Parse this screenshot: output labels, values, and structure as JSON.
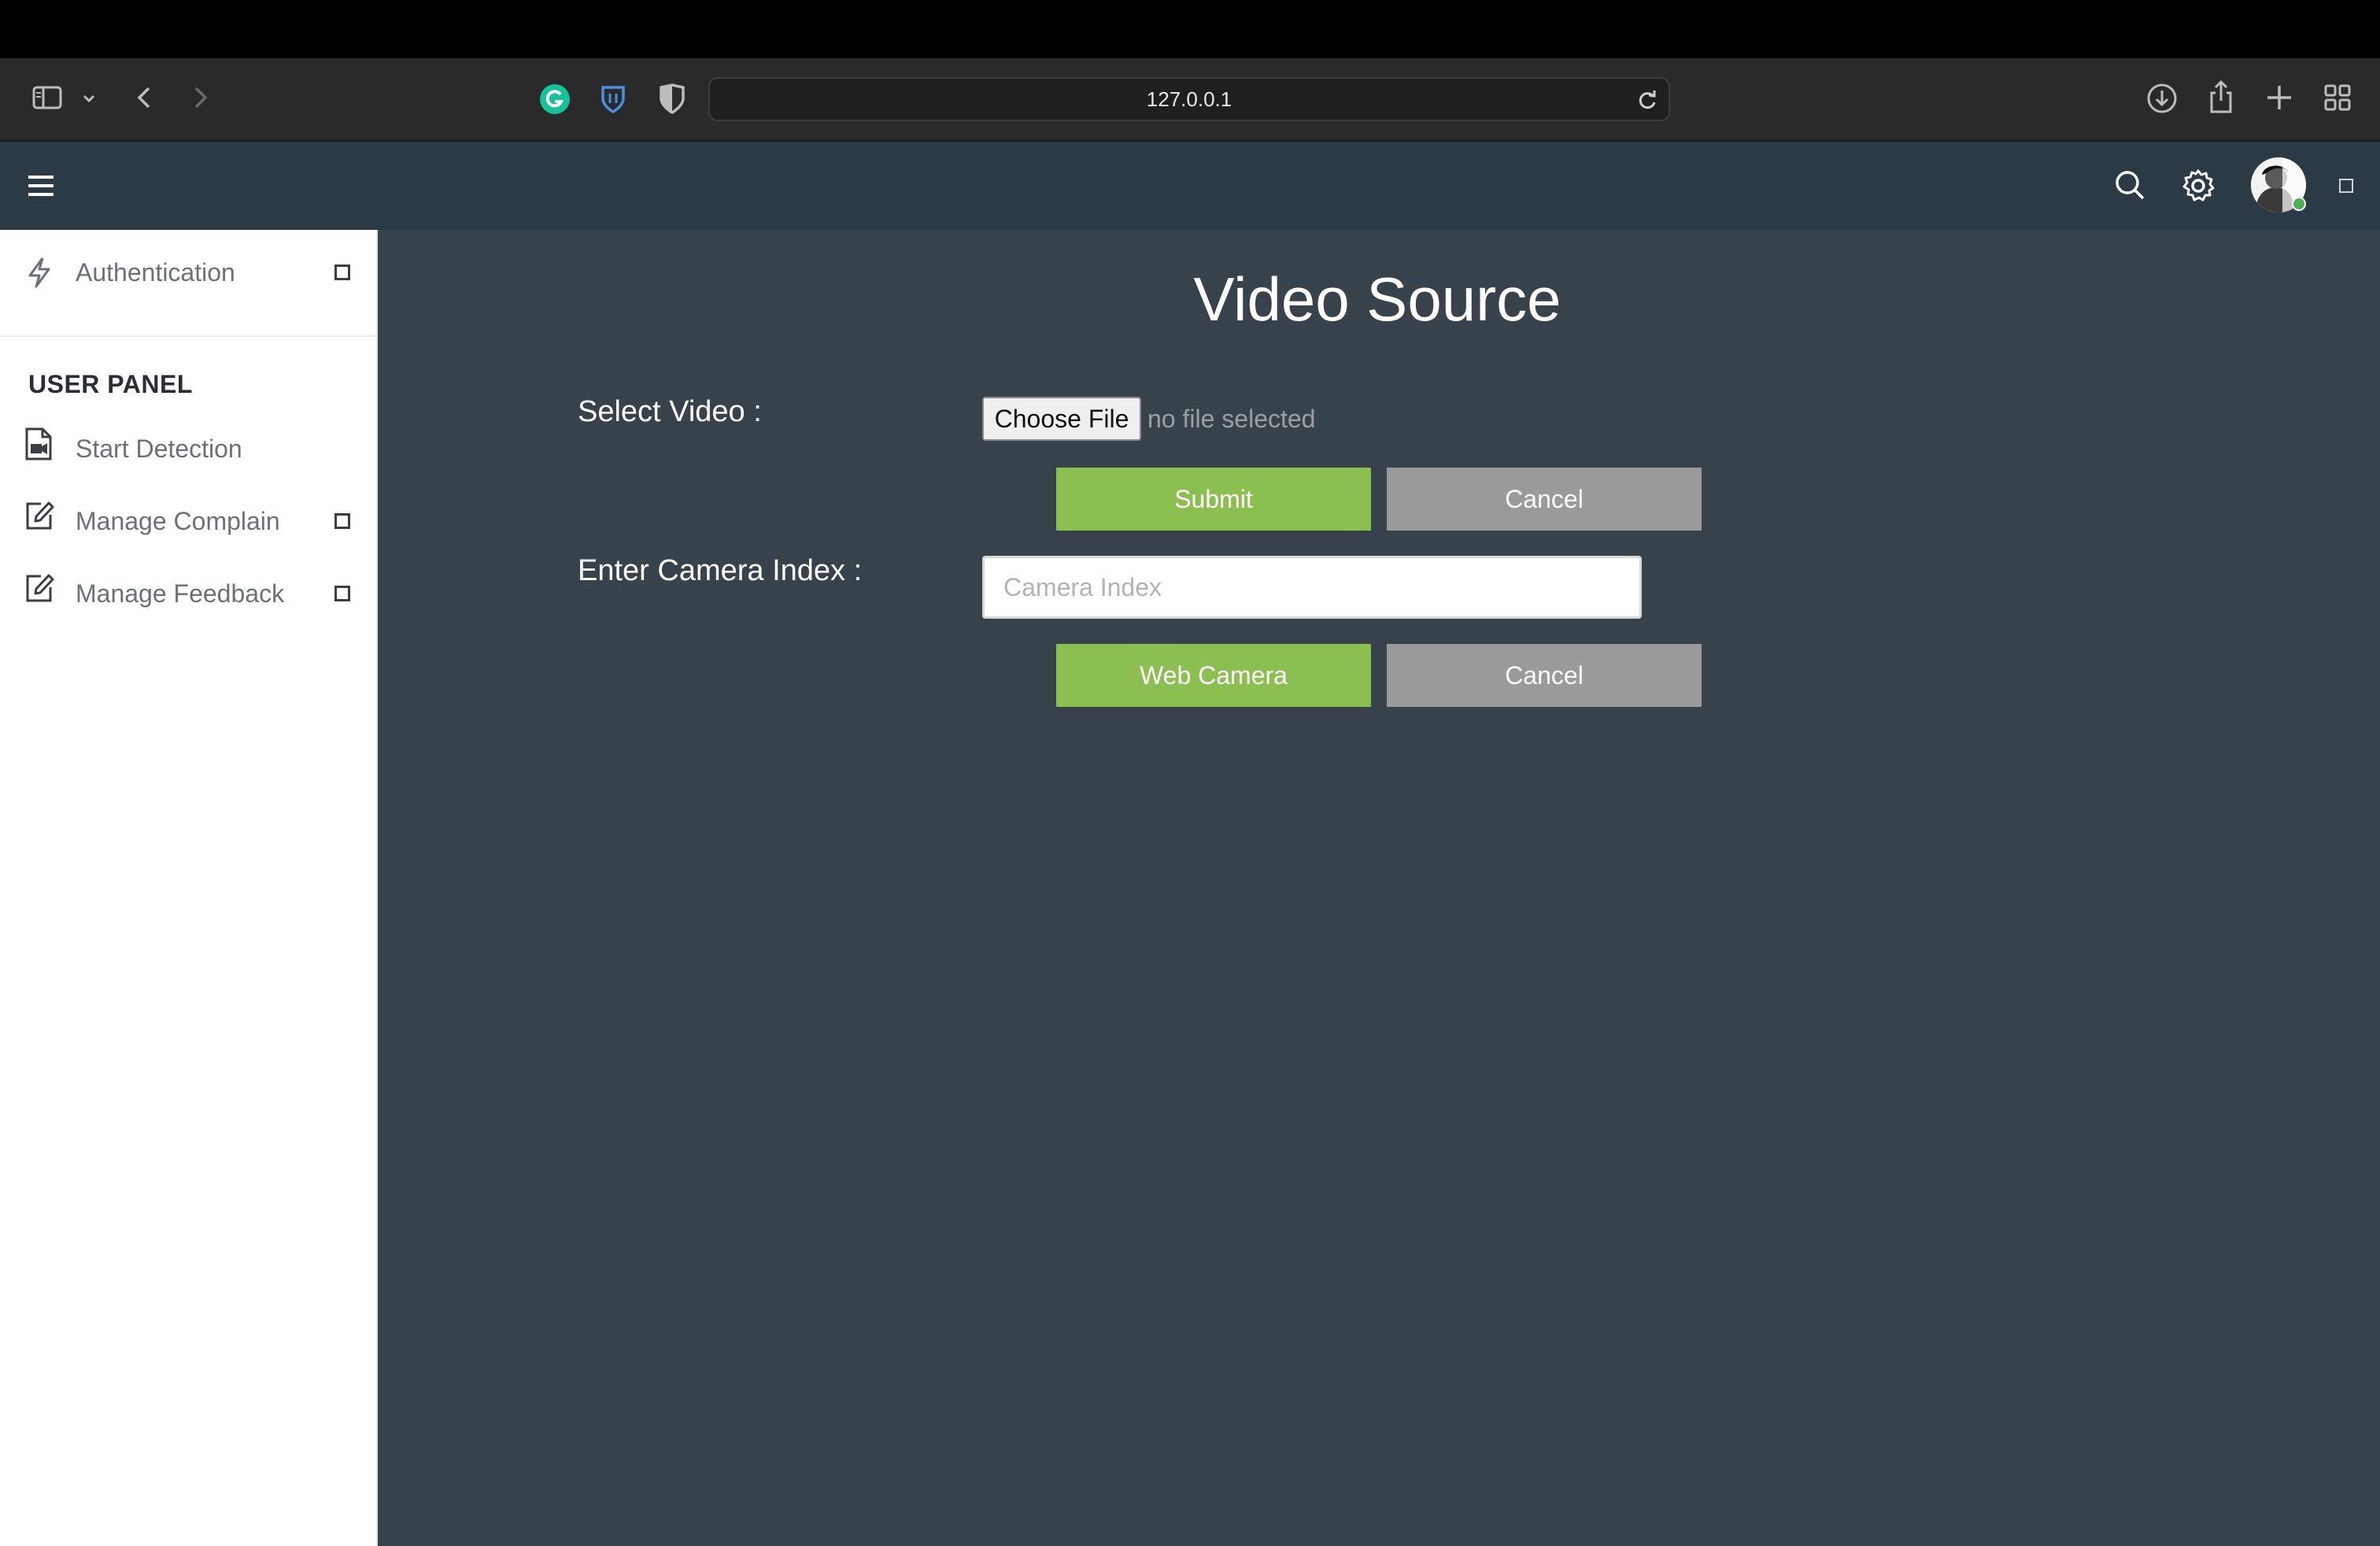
{
  "browser": {
    "url": "127.0.0.1",
    "icons": [
      "sidebar-icon",
      "chevron-down-icon",
      "back-icon",
      "forward-icon",
      "grammarly-icon",
      "bitwarden-icon",
      "shield-icon",
      "reload-icon",
      "download-icon",
      "share-icon",
      "new-tab-icon",
      "tab-overview-icon"
    ]
  },
  "header": {
    "icons": [
      "menu-icon",
      "search-icon",
      "gear-icon",
      "avatar",
      "checkbox-icon"
    ],
    "status_color": "#4caf50"
  },
  "sidebar": {
    "items_top": [
      {
        "label": "Authentication",
        "icon": "lightning-icon"
      }
    ],
    "section_heading": "USER PANEL",
    "items": [
      {
        "label": "Start Detection",
        "icon": "video-file-icon"
      },
      {
        "label": "Manage Complain",
        "icon": "edit-icon"
      },
      {
        "label": "Manage Feedback",
        "icon": "edit-icon"
      }
    ]
  },
  "main": {
    "title": "Video Source",
    "select_video_label": "Select Video :",
    "choose_file_label": "Choose File",
    "file_status": "no file selected",
    "submit_label": "Submit",
    "cancel_label": "Cancel",
    "camera_index_label": "Enter Camera Index :",
    "camera_index_placeholder": "Camera Index",
    "camera_index_value": "",
    "web_camera_label": "Web Camera",
    "cancel2_label": "Cancel"
  },
  "colors": {
    "header_bg": "#2b3a44",
    "main_bg": "#37424a",
    "accent_green": "#8bc051",
    "button_grey": "#9a9a9a"
  }
}
